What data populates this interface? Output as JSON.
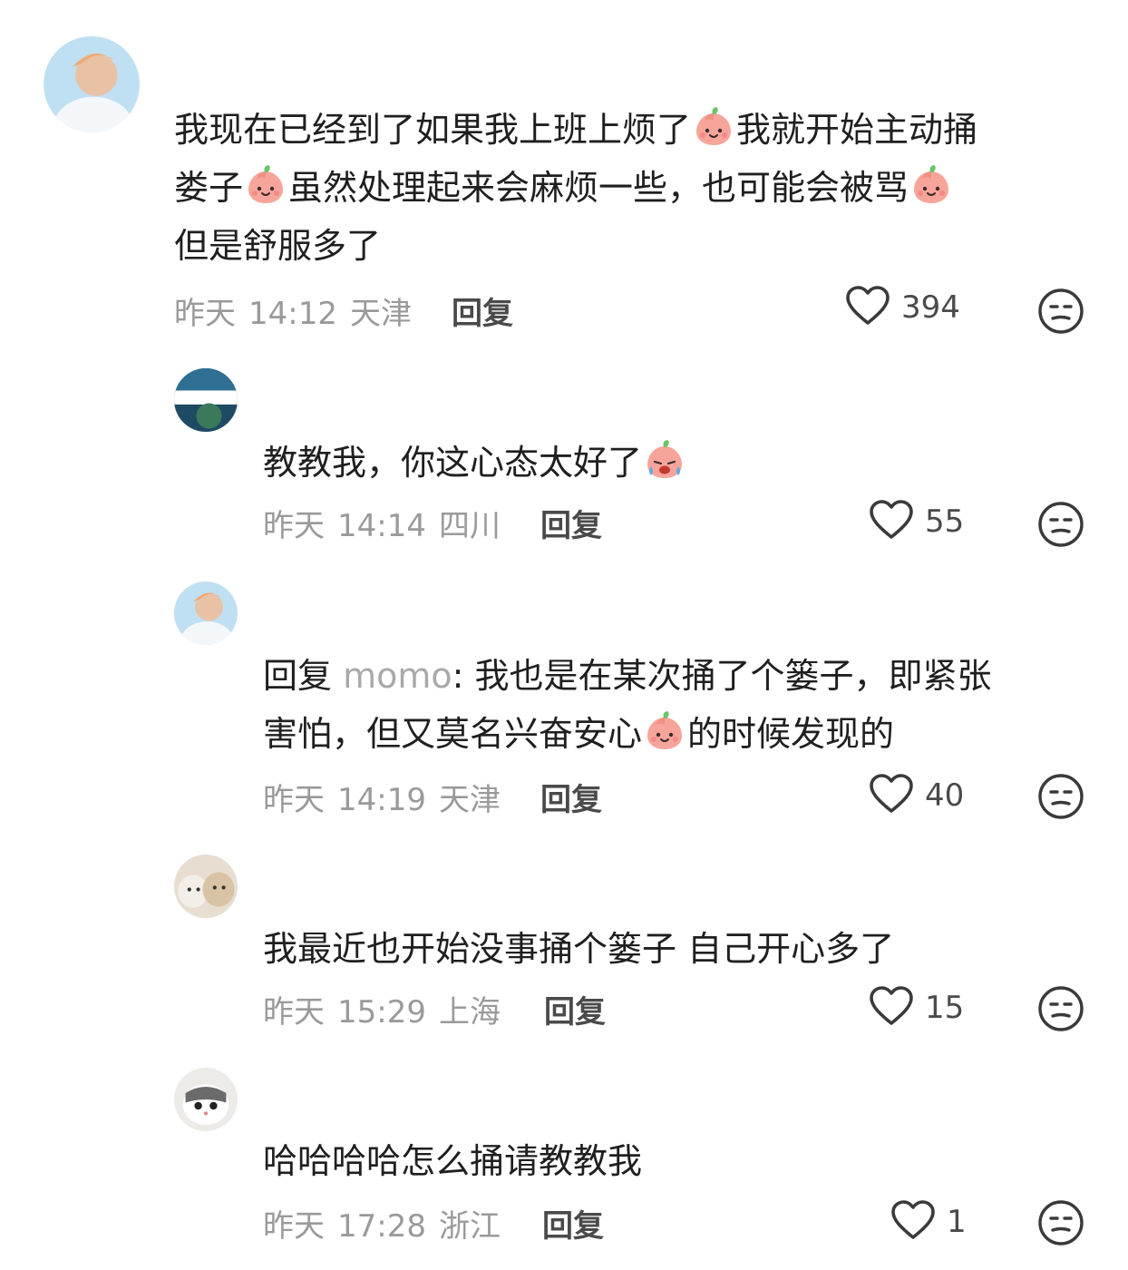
{
  "comments": [
    {
      "username": "",
      "lines": [
        [
          {
            "t": "我现在已经到了如果我上班上烦了"
          },
          {
            "e": "peach-smile"
          },
          {
            "t": "我就开始主动捅"
          }
        ],
        [
          {
            "t": "娄子"
          },
          {
            "e": "peach-smile"
          },
          {
            "t": "虽然处理起来会麻烦一些，也可能会被骂"
          },
          {
            "e": "peach-smile"
          }
        ],
        [
          {
            "t": "但是舒服多了"
          }
        ]
      ],
      "date": "昨天",
      "time": "14:12",
      "location": "天津",
      "reply_label": "回复",
      "likes": "394"
    },
    {
      "username": "",
      "lines": [
        [
          {
            "t": "教教我，你这心态太好了"
          },
          {
            "e": "peach-cry"
          }
        ]
      ],
      "date": "昨天",
      "time": "14:14",
      "location": "四川",
      "reply_label": "回复",
      "likes": "55"
    },
    {
      "username": "",
      "reply_prefix": "回复 ",
      "mention": "momo",
      "lines": [
        [
          {
            "t": ": 我也是在某次捅了个篓子，即紧张"
          }
        ],
        [
          {
            "t": "害怕，但又莫名兴奋安心"
          },
          {
            "e": "peach-smile"
          },
          {
            "t": "的时候发现的"
          }
        ]
      ],
      "date": "昨天",
      "time": "14:19",
      "location": "天津",
      "reply_label": "回复",
      "likes": "40"
    },
    {
      "username": "",
      "lines": [
        [
          {
            "t": "我最近也开始没事捅个篓子 自己开心多了"
          }
        ]
      ],
      "date": "昨天",
      "time": "15:29",
      "location": "上海",
      "reply_label": "回复",
      "likes": "15"
    },
    {
      "username": "",
      "lines": [
        [
          {
            "t": "哈哈哈哈怎么捅请教教我"
          }
        ]
      ],
      "date": "昨天",
      "time": "17:28",
      "location": "浙江",
      "reply_label": "回复",
      "likes": "1"
    }
  ],
  "icons": {
    "like": "heart-outline-icon",
    "dislike": "meh-face-icon",
    "peach_smile": "peach-smile-emoji",
    "peach_cry": "peach-cry-emoji"
  },
  "colors": {
    "text": "#1f1f1f",
    "meta": "#9a9a9a",
    "mention": "#a9a9a9"
  }
}
